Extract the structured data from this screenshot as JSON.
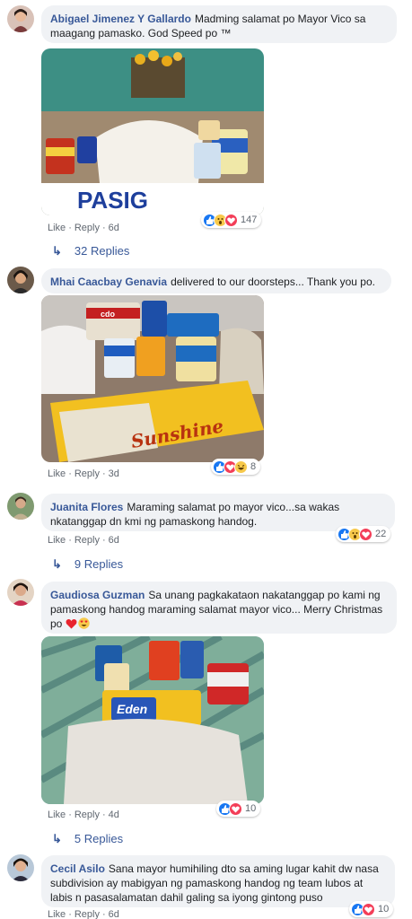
{
  "comments": [
    {
      "author": "Abigael Jimenez Y Gallardo",
      "text": "Madming salamat po Mayor Vico sa maagang pamasko. God Speed po ™",
      "time": "6d",
      "reaction_count": "147",
      "reactions": [
        "like-icon",
        "wow-icon",
        "love-icon"
      ],
      "replies": "32 Replies"
    },
    {
      "author": "Mhai Caacbay Genavia",
      "text": "delivered to our doorsteps... Thank you po.",
      "time": "3d",
      "reaction_count": "8",
      "reactions": [
        "like-icon",
        "love-icon",
        "haha-icon"
      ]
    },
    {
      "author": "Juanita Flores",
      "text": "Maraming salamat po mayor vico...sa wakas nkatanggap dn kmi ng pamaskong handog.",
      "time": "6d",
      "reaction_count": "22",
      "reactions": [
        "like-icon",
        "wow-icon",
        "love-icon"
      ],
      "replies": "9 Replies"
    },
    {
      "author": "Gaudiosa Guzman",
      "text": "Sa unang pagkakataon nakatanggap po kami ng pamaskong handog maraming salamat mayor vico... Merry Christmas po",
      "time": "4d",
      "reaction_count": "10",
      "reactions": [
        "like-icon",
        "love-icon"
      ],
      "replies": "5 Replies"
    },
    {
      "author": "Cecil Asilo",
      "text": "Sana mayor humihiling dto sa aming lugar kahit dw nasa subdivision ay mabigyan ng pamaskong handog ng team lubos at labis n pasasalamatan dahil galing sa iyong gintong puso",
      "time": "6d",
      "reaction_count": "10",
      "reactions": [
        "like-icon",
        "love-icon"
      ]
    }
  ],
  "labels": {
    "like": "Like",
    "reply": "Reply"
  },
  "photo_text": {
    "bag": "PASIG",
    "noodles": "Sunshine",
    "cheese": "Eden"
  },
  "colors": {
    "link": "#385898",
    "bubble": "#f0f2f5",
    "meta": "#606770"
  }
}
